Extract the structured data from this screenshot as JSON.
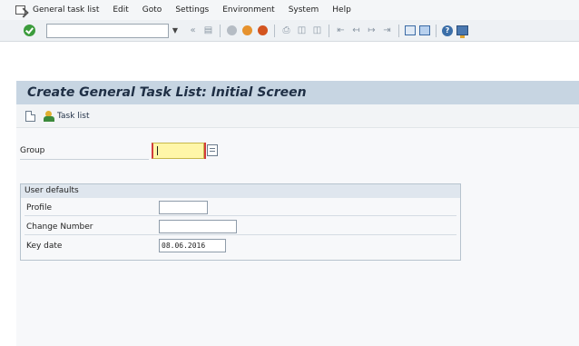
{
  "menu": {
    "items": [
      {
        "label": "General task list"
      },
      {
        "label": "Edit"
      },
      {
        "label": "Goto"
      },
      {
        "label": "Settings"
      },
      {
        "label": "Environment"
      },
      {
        "label": "System"
      },
      {
        "label": "Help"
      }
    ]
  },
  "toolbar": {
    "command_field_value": "",
    "icons": [
      "enter-icon",
      "back-icon",
      "save-icon",
      "exit-icon",
      "cancel-icon",
      "print-icon",
      "find-icon",
      "find-next-icon",
      "first-page-icon",
      "previous-page-icon",
      "next-page-icon",
      "last-page-icon",
      "new-session-icon",
      "shortcut-icon",
      "help-icon",
      "customize-layout-icon"
    ]
  },
  "title": "Create General Task List: Initial Screen",
  "app_toolbar": {
    "task_list_label": "Task list"
  },
  "group": {
    "label": "Group",
    "value": ""
  },
  "user_defaults": {
    "title": "User defaults",
    "profile_label": "Profile",
    "profile_value": "",
    "change_number_label": "Change Number",
    "change_number_value": "",
    "key_date_label": "Key date",
    "key_date_value": "08.06.2016"
  }
}
